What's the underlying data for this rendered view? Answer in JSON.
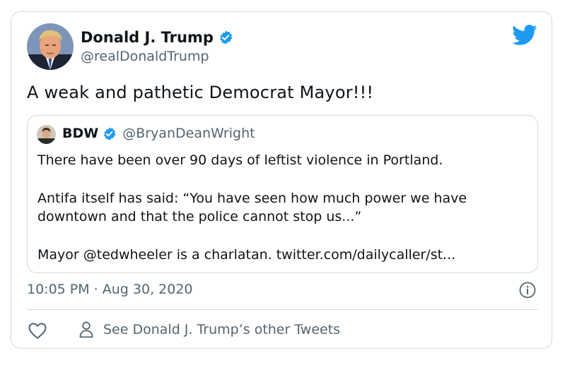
{
  "tweet": {
    "author_name": "Donald J. Trump",
    "author_handle": "@realDonaldTrump",
    "text": "A weak and pathetic Democrat Mayor!!!",
    "timestamp": "10:05 PM · Aug 30, 2020"
  },
  "quoted_tweet": {
    "author_name": "BDW",
    "author_handle": "@BryanDeanWright",
    "lines": [
      "There have been over 90 days of leftist violence in Portland.",
      "Antifa itself has said: “You have seen how much power we have",
      "downtown and that the police cannot stop us...”",
      "Mayor @tedwheeler is a charlatan. twitter.com/dailycaller/st..."
    ]
  },
  "actions": {
    "see_others_label": "See Donald J. Trump’s other Tweets"
  },
  "icons": {
    "brand": "twitter-bird-icon",
    "verified": "verified-badge-icon",
    "info": "info-icon",
    "like": "heart-icon",
    "profile": "person-icon"
  },
  "colors": {
    "twitter_blue": "#1d9bf0",
    "text_primary": "#0f1419",
    "text_secondary": "#536471",
    "border": "#cfd9de"
  }
}
